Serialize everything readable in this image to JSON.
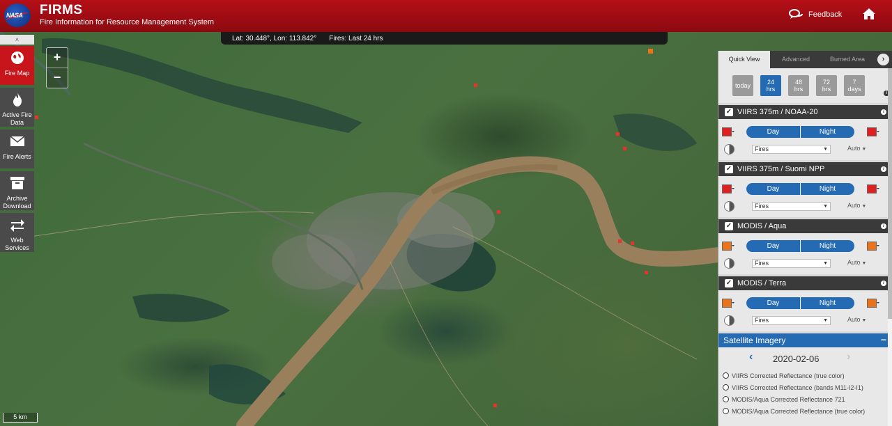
{
  "header": {
    "logo_text": "NASA",
    "title": "FIRMS",
    "subtitle": "Fire Information for Resource Management System",
    "feedback_label": "Feedback"
  },
  "map": {
    "coords": "Lat: 30.448°, Lon: 113.842°",
    "fires_label": "Fires: Last 24 hrs",
    "zoom_in": "+",
    "zoom_out": "−",
    "scale_label": "5 km"
  },
  "leftnav": {
    "collapse": "˄",
    "items": [
      {
        "label": "Fire Map"
      },
      {
        "label": "Active Fire Data"
      },
      {
        "label": "Fire Alerts"
      },
      {
        "label": "Archive Download"
      },
      {
        "label": "Web Services"
      }
    ]
  },
  "panel": {
    "tabs": [
      "Quick View",
      "Advanced",
      "Burned Area"
    ],
    "tab_next": "›",
    "time": {
      "today": "today",
      "h24": [
        "24",
        "hrs"
      ],
      "h48": [
        "48",
        "hrs"
      ],
      "h72": [
        "72",
        "hrs"
      ],
      "d7": [
        "7",
        "days"
      ]
    },
    "layers": [
      {
        "name": "VIIRS 375m / NOAA-20",
        "day": "Day",
        "night": "Night",
        "type": "Fires",
        "auto": "Auto",
        "color": "#e02020"
      },
      {
        "name": "VIIRS 375m / Suomi NPP",
        "day": "Day",
        "night": "Night",
        "type": "Fires",
        "auto": "Auto",
        "color": "#e02020"
      },
      {
        "name": "MODIS / Aqua",
        "day": "Day",
        "night": "Night",
        "type": "Fires",
        "auto": "Auto",
        "color": "#e8731a"
      },
      {
        "name": "MODIS / Terra",
        "day": "Day",
        "night": "Night",
        "type": "Fires",
        "auto": "Auto",
        "color": "#e8731a"
      }
    ],
    "satellite": {
      "title": "Satellite Imagery",
      "collapse": "−",
      "date": "2020-02-06",
      "options": [
        "VIIRS Corrected Reflectance (true color)",
        "VIIRS Corrected Reflectance (bands M11-I2-I1)",
        "MODIS/Aqua Corrected Reflectance 721",
        "MODIS/Aqua Corrected Reflectance (true color)"
      ]
    }
  }
}
